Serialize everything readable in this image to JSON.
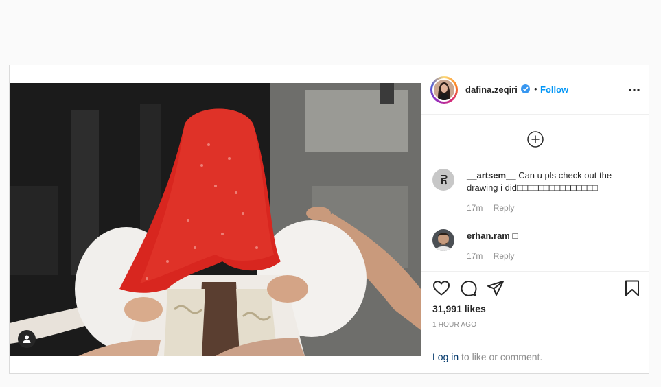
{
  "post": {
    "username": "dafina.zeqiri",
    "separator": "•",
    "follow_label": "Follow",
    "likes": "31,991 likes",
    "timestamp": "1 HOUR AGO"
  },
  "comments": [
    {
      "user": "__artsem__",
      "text": "Can u pls check out the drawing i did□□□□□□□□□□□□□□□",
      "age": "17m",
      "reply": "Reply"
    },
    {
      "user": "erhan.ram",
      "text": "□",
      "age": "17m",
      "reply": "Reply"
    }
  ],
  "login": {
    "link": "Log in",
    "suffix": " to like or comment."
  },
  "colors": {
    "accent": "#0095f6",
    "veil": "#d8261f",
    "link": "#00376b"
  },
  "icons": [
    "tag-user-icon",
    "verified-icon",
    "more-options-icon",
    "add-circle-icon",
    "heart-icon",
    "comment-icon",
    "share-icon",
    "bookmark-icon"
  ]
}
